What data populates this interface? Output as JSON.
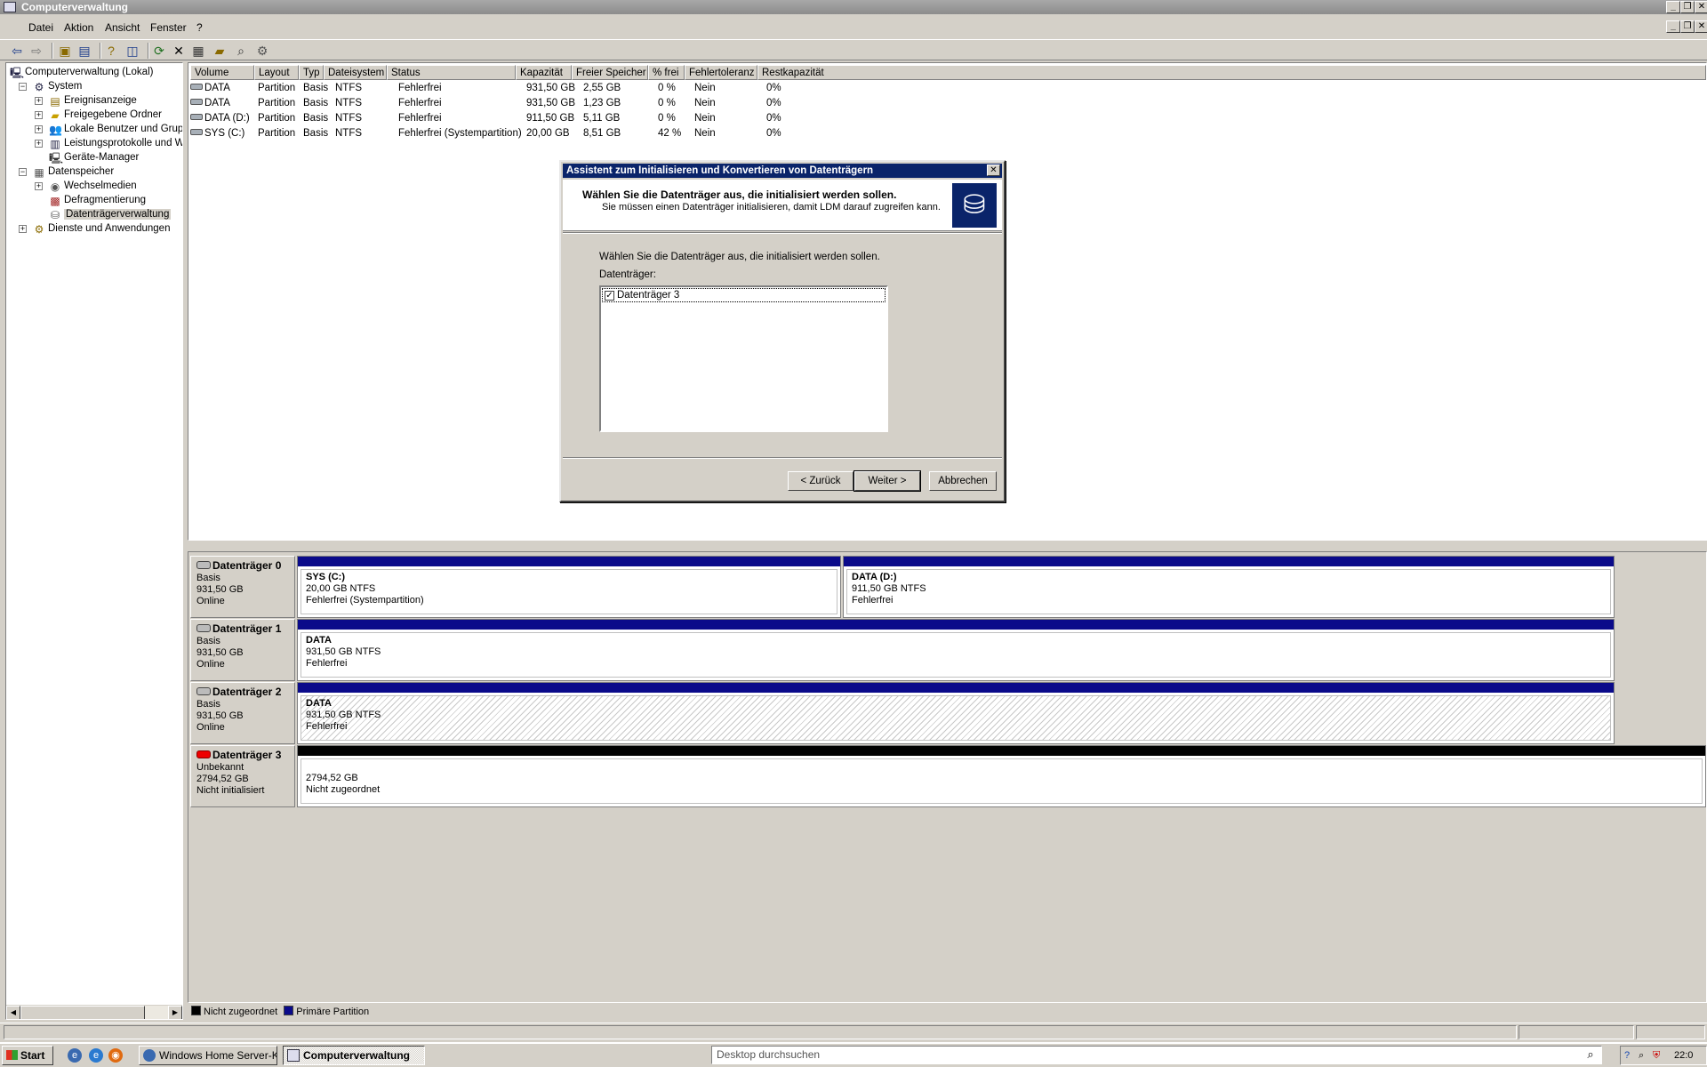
{
  "window": {
    "title": "Computerverwaltung"
  },
  "menubar": {
    "items": [
      "Datei",
      "Aktion",
      "Ansicht",
      "Fenster",
      "?"
    ]
  },
  "tree": {
    "root": "Computerverwaltung (Lokal)",
    "system": "System",
    "ereignisanzeige": "Ereignisanzeige",
    "freigegebene_ordner": "Freigegebene Ordner",
    "lokale_benutzer": "Lokale Benutzer und Gruppe",
    "leistungsprotokolle": "Leistungsprotokolle und War",
    "geraete_manager": "Geräte-Manager",
    "datenspeicher": "Datenspeicher",
    "wechselmedien": "Wechselmedien",
    "defragmentierung": "Defragmentierung",
    "datentraegerverwaltung": "Datenträgerverwaltung",
    "dienste": "Dienste und Anwendungen"
  },
  "volume_list": {
    "columns": [
      "Volume",
      "Layout",
      "Typ",
      "Dateisystem",
      "Status",
      "Kapazität",
      "Freier Speicher",
      "% frei",
      "Fehlertoleranz",
      "Restkapazität"
    ],
    "rows": [
      [
        "DATA",
        "Partition",
        "Basis",
        "NTFS",
        "Fehlerfrei",
        "931,50 GB",
        "2,55 GB",
        "0 %",
        "Nein",
        "0%"
      ],
      [
        "DATA",
        "Partition",
        "Basis",
        "NTFS",
        "Fehlerfrei",
        "931,50 GB",
        "1,23 GB",
        "0 %",
        "Nein",
        "0%"
      ],
      [
        "DATA (D:)",
        "Partition",
        "Basis",
        "NTFS",
        "Fehlerfrei",
        "911,50 GB",
        "5,11 GB",
        "0 %",
        "Nein",
        "0%"
      ],
      [
        "SYS (C:)",
        "Partition",
        "Basis",
        "NTFS",
        "Fehlerfrei (Systempartition)",
        "20,00 GB",
        "8,51 GB",
        "42 %",
        "Nein",
        "0%"
      ]
    ]
  },
  "disks": [
    {
      "name": "Datenträger 0",
      "type": "Basis",
      "size": "931,50 GB",
      "state": "Online",
      "partitions": [
        {
          "name": "SYS  (C:)",
          "size": "20,00 GB NTFS",
          "status": "Fehlerfrei (Systempartition)"
        },
        {
          "name": "DATA  (D:)",
          "size": "911,50 GB NTFS",
          "status": "Fehlerfrei"
        }
      ]
    },
    {
      "name": "Datenträger 1",
      "type": "Basis",
      "size": "931,50 GB",
      "state": "Online",
      "partitions": [
        {
          "name": "DATA",
          "size": "931,50 GB NTFS",
          "status": "Fehlerfrei"
        }
      ]
    },
    {
      "name": "Datenträger 2",
      "type": "Basis",
      "size": "931,50 GB",
      "state": "Online",
      "partitions": [
        {
          "name": "DATA",
          "size": "931,50 GB NTFS",
          "status": "Fehlerfrei"
        }
      ]
    },
    {
      "name": "Datenträger 3",
      "type": "Unbekannt",
      "size": "2794,52 GB",
      "state": "Nicht initialisiert",
      "partitions": [
        {
          "name": "",
          "size": "2794,52 GB",
          "status": "Nicht zugeordnet"
        }
      ]
    }
  ],
  "legend": {
    "unallocated": "Nicht zugeordnet",
    "primary": "Primäre Partition",
    "unallocated_color": "#000000",
    "primary_color": "#0a0a8a"
  },
  "wizard": {
    "title": "Assistent zum Initialisieren und Konvertieren von Datenträgern",
    "header_title": "Wählen Sie die Datenträger aus, die initialisiert werden sollen.",
    "header_subtitle": "Sie müssen einen Datenträger initialisieren, damit LDM darauf zugreifen kann.",
    "prompt": "Wählen Sie die Datenträger aus, die initialisiert werden sollen.",
    "list_label": "Datenträger:",
    "disk_item": "Datenträger 3",
    "disk_item_checked": true,
    "back_label": "< Zurück",
    "next_label": "Weiter >",
    "cancel_label": "Abbrechen",
    "title_bar_color": "#0a246a"
  },
  "taskbar": {
    "start_label": "Start",
    "tasks": [
      "Windows Home Server-K...",
      "Computerverwaltung"
    ],
    "search_placeholder": "Desktop durchsuchen",
    "clock": "22:0"
  }
}
